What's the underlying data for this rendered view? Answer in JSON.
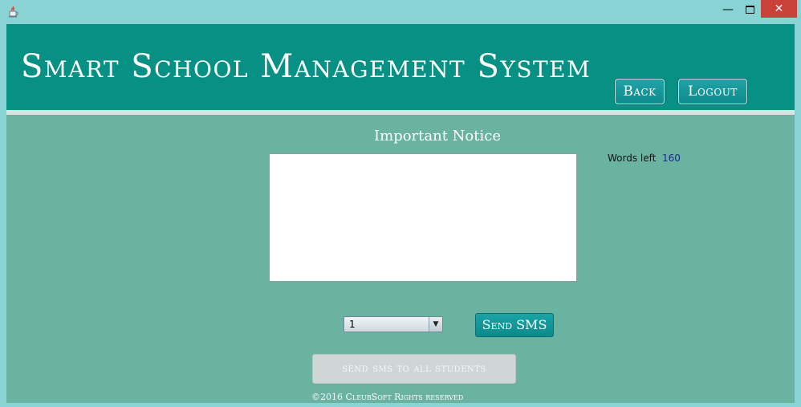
{
  "window": {
    "minimize_glyph": "—",
    "close_glyph": "✕",
    "app_icon": "java-cup-icon"
  },
  "header": {
    "title": "Smart School Management System",
    "back_label": "Back",
    "logout_label": "Logout"
  },
  "notice": {
    "heading": "Important Notice",
    "text": "",
    "words_left_label": "Words left",
    "words_left_value": "160"
  },
  "controls": {
    "class_select_value": "1",
    "send_sms_label": "Send SMS",
    "send_all_label": "send sms to all students",
    "send_all_enabled": false
  },
  "footer": {
    "copyright": "©2016 CleubSoft Rights reserved"
  },
  "colors": {
    "header_bg": "#079184",
    "body_bg": "#69b3a0",
    "window_border": "#8ad3d4",
    "close_red": "#c9423a"
  }
}
